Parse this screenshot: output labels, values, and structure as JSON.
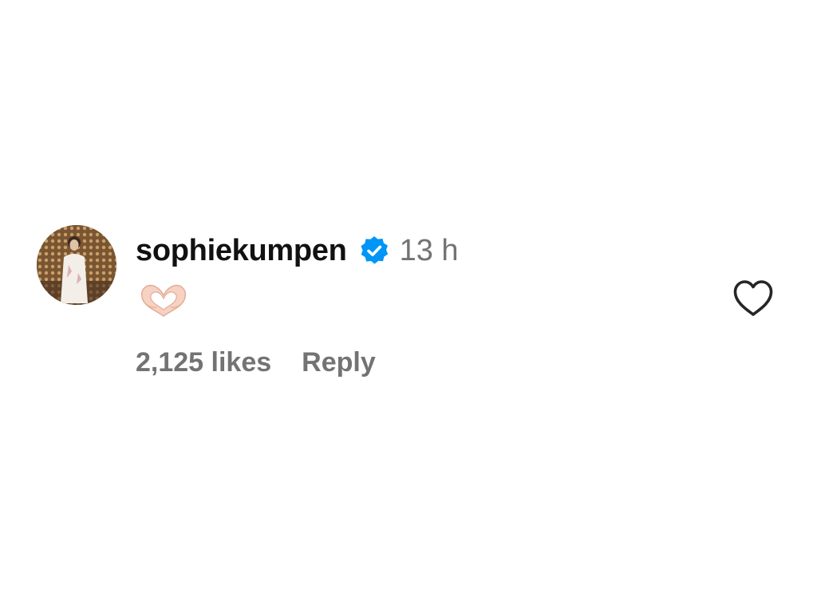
{
  "comment": {
    "username": "sophiekumpen",
    "verified": true,
    "timestamp": "13 h",
    "body_emoji": "🫶",
    "likes_text": "2,125 likes",
    "reply_label": "Reply",
    "liked": false
  },
  "icons": {
    "verified": "verified-badge-icon",
    "like": "heart-outline-icon"
  },
  "colors": {
    "text_primary": "#111111",
    "text_secondary": "#737373",
    "verified_blue": "#0095f6",
    "background": "#ffffff"
  }
}
